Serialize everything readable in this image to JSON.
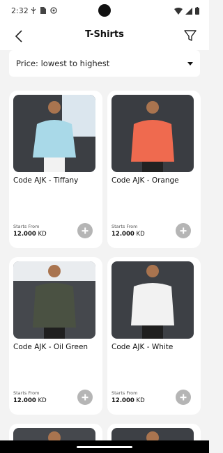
{
  "status": {
    "time": "2:32"
  },
  "header": {
    "title": "T-Shirts"
  },
  "sort": {
    "label": "Price: lowest to highest"
  },
  "products": [
    {
      "name": "Code AJK - Tiffany",
      "starts_from": "Starts From",
      "price": "12.000",
      "currency": "KD",
      "color": "#a9d9e8",
      "image_icon": "model-in-polo-shirt"
    },
    {
      "name": "Code AJK - Orange",
      "starts_from": "Starts From",
      "price": "12.000",
      "currency": "KD",
      "color": "#ef6a4f",
      "image_icon": "model-in-polo-shirt"
    },
    {
      "name": "Code AJK - Oil Green",
      "starts_from": "Starts From",
      "price": "12.000",
      "currency": "KD",
      "color": "#4a5142",
      "image_icon": "model-in-polo-shirt"
    },
    {
      "name": "Code AJK - White",
      "starts_from": "Starts From",
      "price": "12.000",
      "currency": "KD",
      "color": "#f2f2f2",
      "image_icon": "model-in-polo-shirt"
    }
  ],
  "icons": {
    "back": "back-arrow-icon",
    "filter": "funnel-icon",
    "add": "plus-icon"
  }
}
